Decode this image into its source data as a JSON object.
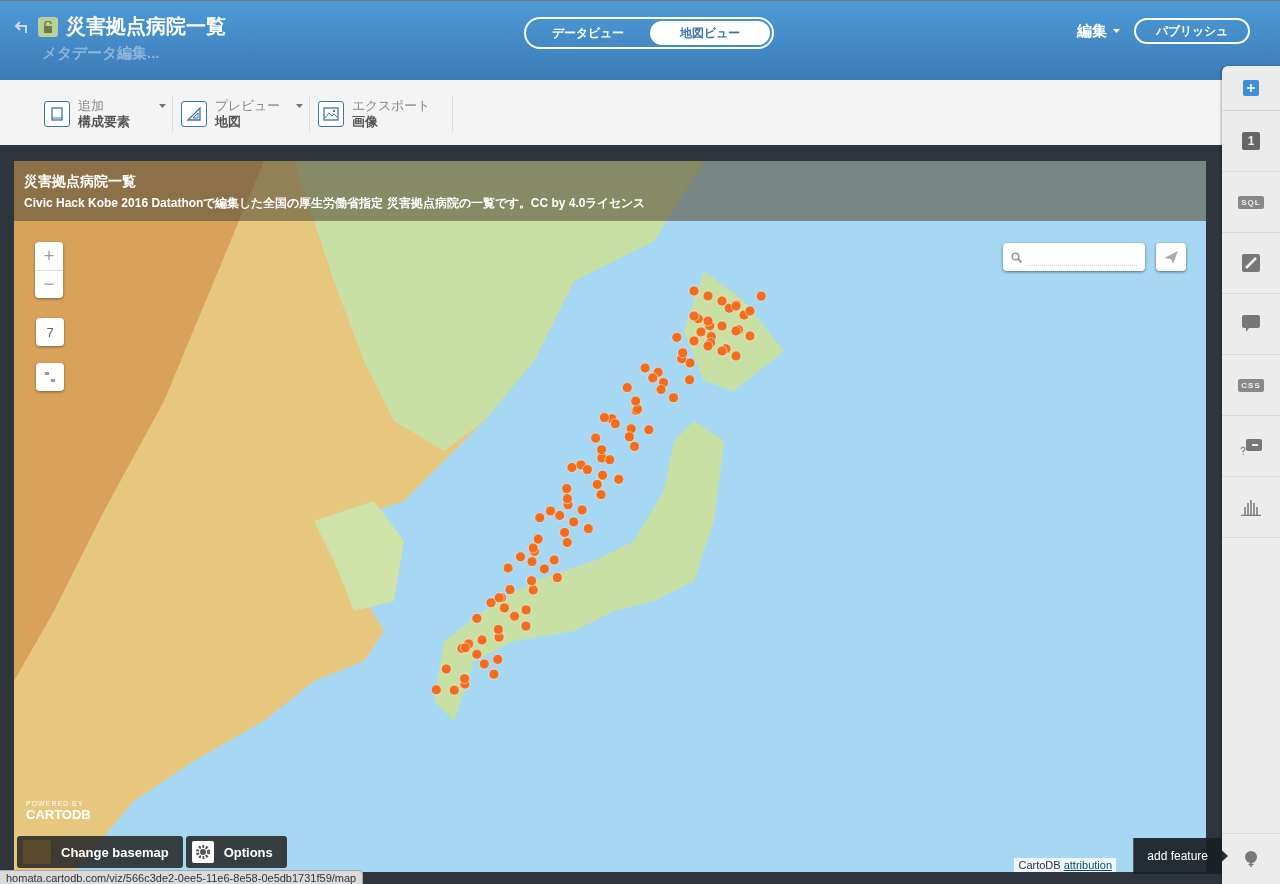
{
  "header": {
    "title": "災害拠点病院一覧",
    "subtitle": "メタデータ編集...",
    "views": [
      {
        "label": "データビュー",
        "selected": false
      },
      {
        "label": "地図ビュー",
        "selected": true
      }
    ],
    "edit_menu": "編集",
    "publish_button": "パブリッシュ"
  },
  "toolbar": [
    {
      "label": "追加",
      "sublabel": "構成要素",
      "dropdown": true
    },
    {
      "label": "プレビュー",
      "sublabel": "地図",
      "dropdown": true
    },
    {
      "label": "エクスポート",
      "sublabel": "画像",
      "dropdown": false
    }
  ],
  "map": {
    "title": "災害拠点病院一覧",
    "description": "Civic Hack Kobe 2016 Datathonで編集した全国の厚生労働省指定 災害拠点病院の一覧です。CC by 4.0ライセンス",
    "zoom_in": "+",
    "zoom_out": "−",
    "zoom_level": "7",
    "logo_small": "POWERED BY",
    "logo": "CARTODB",
    "basemap_button": "Change basemap",
    "options_button": "Options",
    "attribution": "CartoDB",
    "attribution_link": "attribution"
  },
  "sidebar": {
    "items": [
      {
        "kind": "number",
        "label": "1"
      },
      {
        "kind": "badge",
        "label": "SQL"
      },
      {
        "kind": "brush"
      },
      {
        "kind": "comment"
      },
      {
        "kind": "badge",
        "label": "CSS"
      },
      {
        "kind": "legend"
      },
      {
        "kind": "chart"
      }
    ],
    "tooltip": "add feature"
  },
  "status_bar": "homata.cartodb.com/viz/566c3de2-0ee5-11e6-8e58-0e5db1731f59/map"
}
